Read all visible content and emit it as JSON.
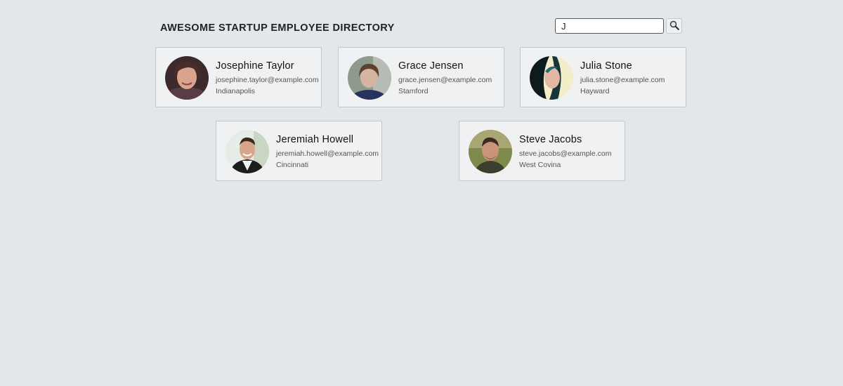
{
  "header": {
    "title": "AWESOME STARTUP EMPLOYEE DIRECTORY"
  },
  "search": {
    "value": "J",
    "button_icon": "magnifier-icon"
  },
  "employees": [
    {
      "name": "Josephine Taylor",
      "email": "josephine.taylor@example.com",
      "location": "Indianapolis"
    },
    {
      "name": "Grace Jensen",
      "email": "grace.jensen@example.com",
      "location": "Stamford"
    },
    {
      "name": "Julia Stone",
      "email": "julia.stone@example.com",
      "location": "Hayward"
    },
    {
      "name": "Jeremiah Howell",
      "email": "jeremiah.howell@example.com",
      "location": "Cincinnati"
    },
    {
      "name": "Steve Jacobs",
      "email": "steve.jacobs@example.com",
      "location": "West Covina"
    }
  ],
  "colors": {
    "background": "#e4e7ea",
    "card": "#f0f1f3",
    "card_border": "#c4c7ca"
  }
}
